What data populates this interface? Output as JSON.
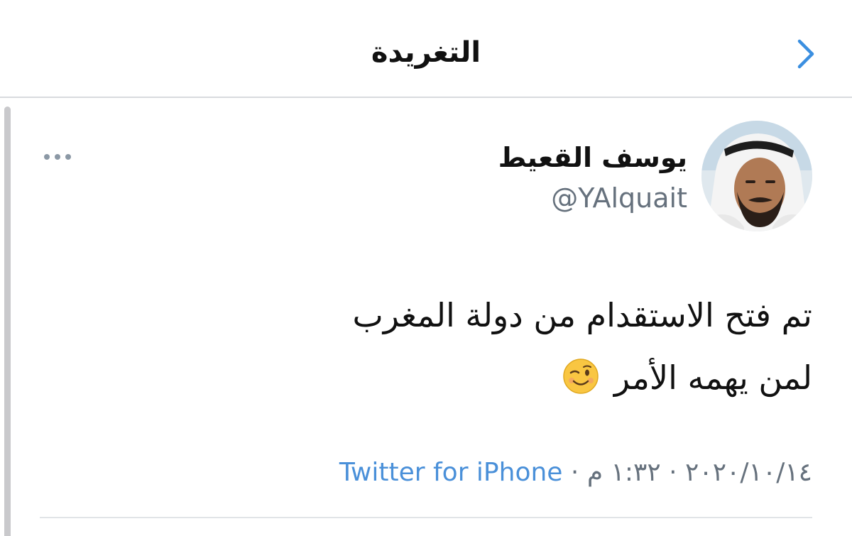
{
  "header": {
    "title": "التغريدة",
    "back_icon": "chevron-right-icon",
    "accent_color": "#3b8fe0"
  },
  "tweet": {
    "display_name": "يوسف القعيط",
    "handle": "@YAlquait",
    "more_icon": "ellipsis-icon",
    "text_line_1": "تم فتح الاستقدام من دولة المغرب",
    "text_line_2": "لمن يهمه الأمر",
    "emoji": "winking-face-emoji",
    "date": "٢٠٢٠/١٠/١٤",
    "separator": "·",
    "time": "١:٣٢ م",
    "source": "Twitter for iPhone",
    "source_color": "#4a90d9"
  }
}
